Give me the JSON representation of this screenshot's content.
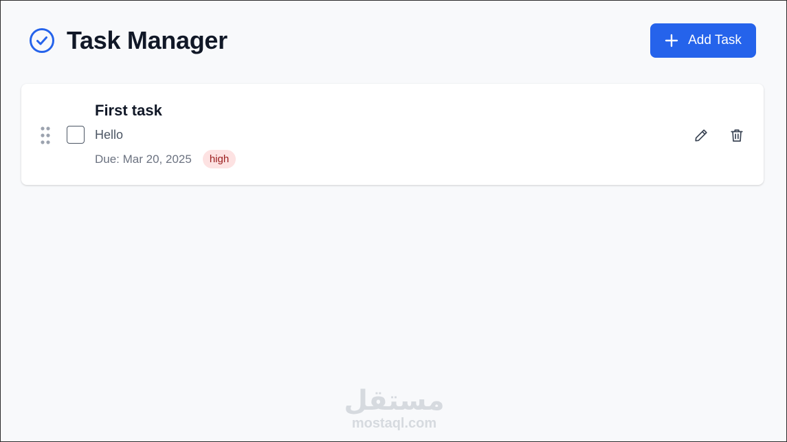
{
  "header": {
    "title": "Task Manager",
    "add_button_label": "Add Task",
    "icon": "check-circle-icon"
  },
  "tasks": [
    {
      "title": "First task",
      "description": "Hello",
      "due": "Due: Mar 20, 2025",
      "priority": "high",
      "completed": false
    }
  ],
  "colors": {
    "accent": "#2563eb",
    "priority_high_bg": "#fde2e2",
    "priority_high_text": "#991b1b",
    "page_bg": "#f8f9fb"
  },
  "watermark": {
    "arabic": "مستقل",
    "latin": "mostaql.com"
  }
}
